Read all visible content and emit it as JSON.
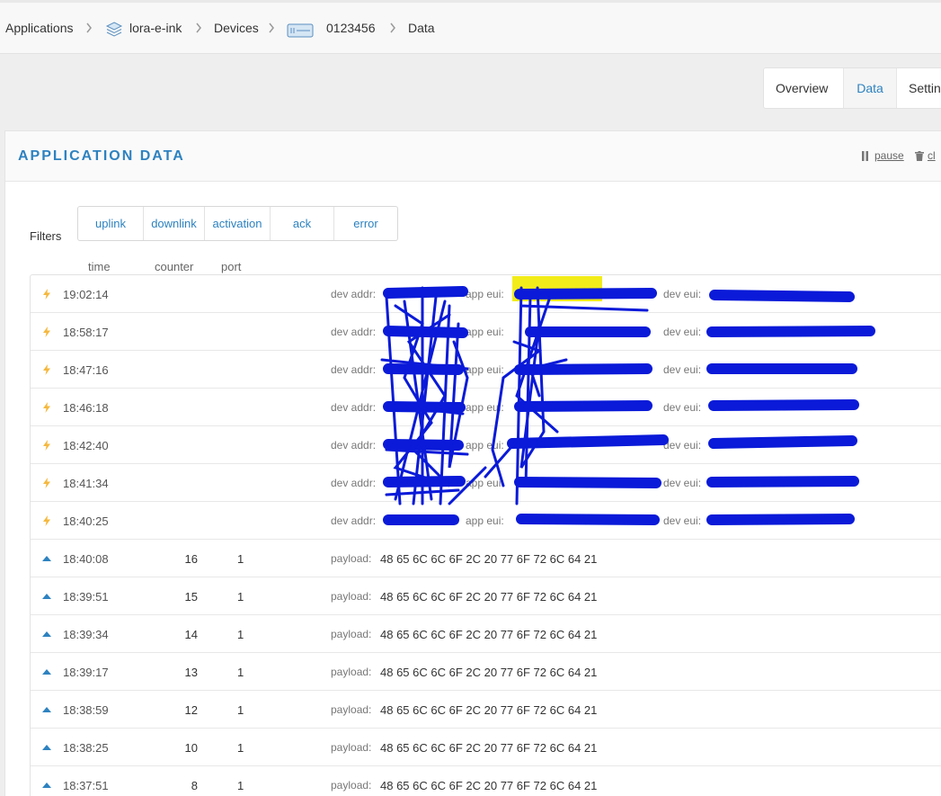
{
  "breadcrumb": {
    "applications": "Applications",
    "app": "lora-e-ink",
    "devices": "Devices",
    "device": "0123456",
    "current": "Data"
  },
  "tabs": {
    "overview": "Overview",
    "data": "Data",
    "settings": "Settin"
  },
  "card": {
    "title": "APPLICATION DATA",
    "pause": "pause",
    "clear": "cl"
  },
  "filters": {
    "label": "Filters",
    "buttons": [
      "uplink",
      "downlink",
      "activation",
      "ack",
      "error"
    ]
  },
  "columns": {
    "time": "time",
    "counter": "counter",
    "port": "port"
  },
  "labels": {
    "dev_addr": "dev addr:",
    "app_eui": "app eui:",
    "dev_eui": "dev eui:",
    "payload": "payload:"
  },
  "activations": [
    {
      "time": "19:02:14"
    },
    {
      "time": "18:58:17"
    },
    {
      "time": "18:47:16"
    },
    {
      "time": "18:46:18"
    },
    {
      "time": "18:42:40"
    },
    {
      "time": "18:41:34"
    },
    {
      "time": "18:40:25"
    }
  ],
  "uplinks": [
    {
      "time": "18:40:08",
      "counter": "16",
      "port": "1",
      "payload": "48 65 6C 6C 6F 2C 20 77 6F 72 6C 64 21"
    },
    {
      "time": "18:39:51",
      "counter": "15",
      "port": "1",
      "payload": "48 65 6C 6C 6F 2C 20 77 6F 72 6C 64 21"
    },
    {
      "time": "18:39:34",
      "counter": "14",
      "port": "1",
      "payload": "48 65 6C 6C 6F 2C 20 77 6F 72 6C 64 21"
    },
    {
      "time": "18:39:17",
      "counter": "13",
      "port": "1",
      "payload": "48 65 6C 6C 6F 2C 20 77 6F 72 6C 64 21"
    },
    {
      "time": "18:38:59",
      "counter": "12",
      "port": "1",
      "payload": "48 65 6C 6C 6F 2C 20 77 6F 72 6C 64 21"
    },
    {
      "time": "18:38:25",
      "counter": "10",
      "port": "1",
      "payload": "48 65 6C 6C 6F 2C 20 77 6F 72 6C 64 21"
    },
    {
      "time": "18:37:51",
      "counter": "8",
      "port": "1",
      "payload": "48 65 6C 6C 6F 2C 20 77 6F 72 6C 64 21"
    }
  ],
  "colors": {
    "accent": "#2d82c0",
    "activation_icon": "#f5b83d",
    "redaction": "#0a1ad8",
    "highlight": "#f2ec1a"
  }
}
